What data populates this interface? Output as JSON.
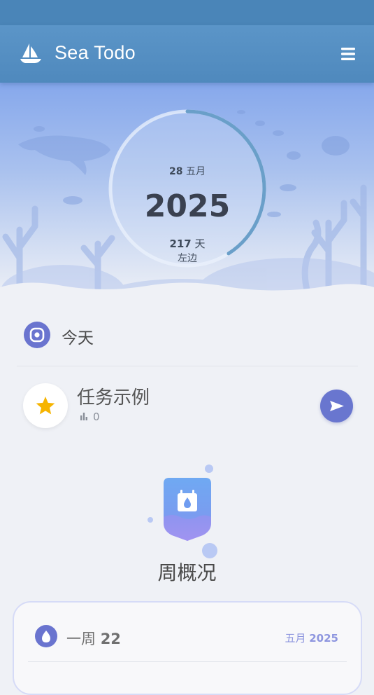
{
  "app": {
    "title": "Sea Todo"
  },
  "header": {
    "logo_icon": "sailboat-icon",
    "menu_icon": "hamburger-menu-icon"
  },
  "dial": {
    "day": "28",
    "month": "五月",
    "year": "2025",
    "days_remaining": "217",
    "days_unit": "天",
    "left_label": "左边",
    "progress_fraction": 0.41
  },
  "today": {
    "label": "今天",
    "icon": "today-icon"
  },
  "task": {
    "title": "任务示例",
    "count": "0",
    "icon": "star-icon",
    "action_icon": "send-icon"
  },
  "week_summary": {
    "title": "周概况",
    "badge_icon": "calendar-drop-icon",
    "week_prefix": "一周",
    "week_number": "22",
    "month": "五月",
    "year": "2025"
  },
  "colors": {
    "app_bar": "#4f89bd",
    "accent": "#6a74cf",
    "star": "#f6b400",
    "progress_arc": "#6a9fc9"
  }
}
